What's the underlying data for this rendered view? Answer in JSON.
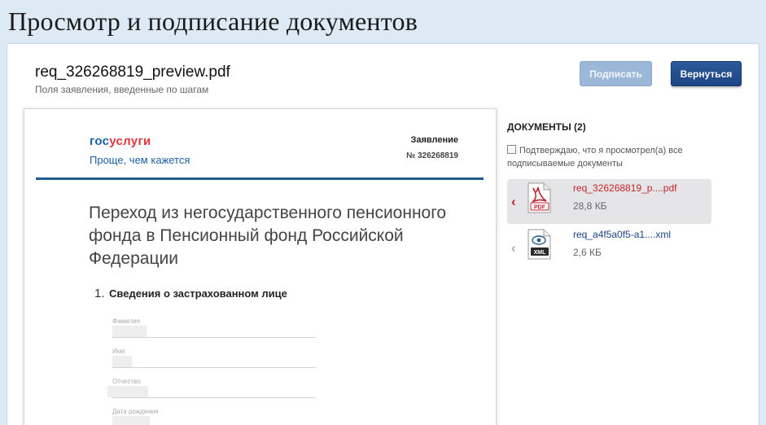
{
  "page": {
    "title": "Просмотр и подписание документов"
  },
  "header": {
    "file_name": "req_326268819_preview.pdf",
    "subtitle": "Поля заявления, введенные по шагам",
    "sign_label": "Подписать",
    "back_label": "Вернуться"
  },
  "document": {
    "logo_part1": "гос",
    "logo_part2": "услуги",
    "slogan": "Проще, чем кажется",
    "statement_label": "Заявление",
    "statement_number": "№ 326268819",
    "heading": "Переход из негосударственного пенсионного фонда в Пенсионный фонд Российской Федерации",
    "section_number": "1.",
    "section_title": "Сведения о застрахованном лице",
    "fields": [
      {
        "label": "Фамилия"
      },
      {
        "label": "Имя"
      },
      {
        "label": "Отчество"
      },
      {
        "label": "Дата рождения"
      }
    ]
  },
  "sidebar": {
    "docs_header": "ДОКУМЕНТЫ (2)",
    "confirm_text": "Подтверждаю, что я просмотрел(а) все подписываемые документы",
    "documents": [
      {
        "name": "req_326268819_p....pdf",
        "size": "28,8 КБ",
        "icon": "pdf-file-icon"
      },
      {
        "name": "req_a4f5a0f5-a1....xml",
        "size": "2,6 КБ",
        "icon": "xml-file-icon"
      }
    ]
  },
  "colors": {
    "accent": "#1d4585",
    "pdf_red": "#c0262d",
    "link_blue": "#1a5fa8"
  }
}
